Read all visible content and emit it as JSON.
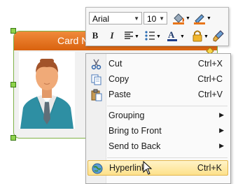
{
  "card": {
    "title": "Card N"
  },
  "toolbar": {
    "font_name": "Arial",
    "font_size": "10",
    "bold_label": "B",
    "italic_label": "I"
  },
  "context_menu": {
    "items": [
      {
        "label": "Cut",
        "shortcut": "Ctrl+X",
        "icon": "scissors-icon"
      },
      {
        "label": "Copy",
        "shortcut": "Ctrl+C",
        "icon": "copy-icon"
      },
      {
        "label": "Paste",
        "shortcut": "Ctrl+V",
        "icon": "paste-icon"
      },
      {
        "label": "Grouping",
        "submenu": true
      },
      {
        "label": "Bring to Front",
        "submenu": true
      },
      {
        "label": "Send to Back",
        "submenu": true
      },
      {
        "label": "Hyperlink",
        "shortcut": "Ctrl+K",
        "icon": "hyperlink-globe-icon",
        "highlighted": true
      }
    ]
  },
  "colors": {
    "header_orange": "#e87722",
    "selection_green": "#7fb246",
    "highlight": "#fde18a"
  }
}
